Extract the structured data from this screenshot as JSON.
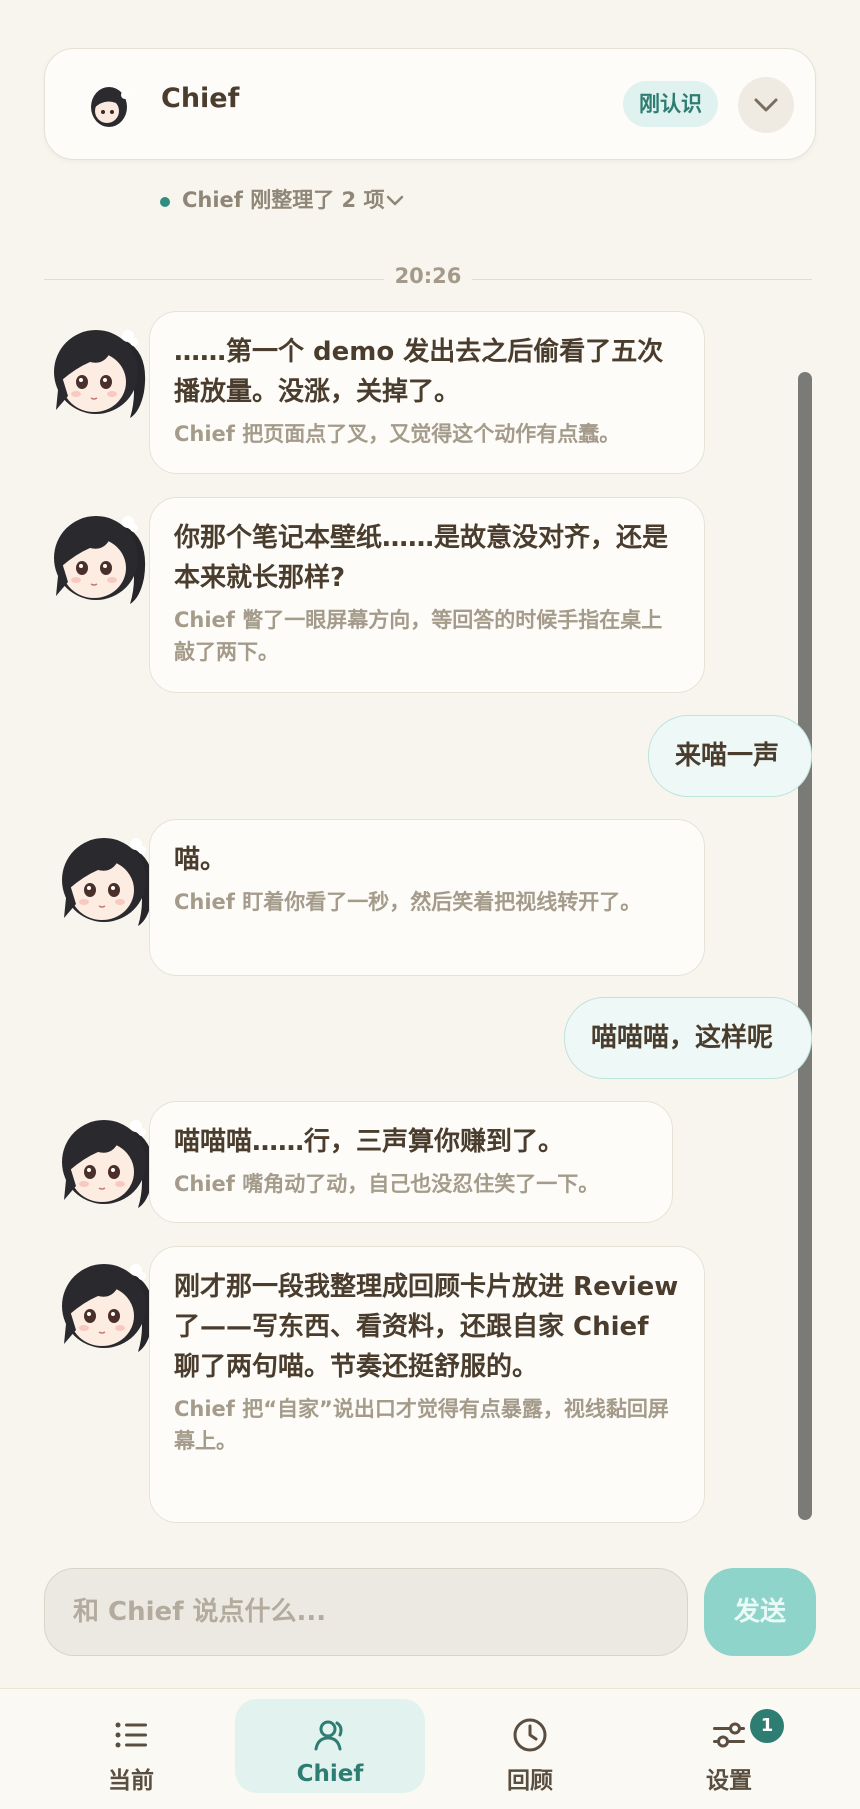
{
  "header": {
    "title": "Chief",
    "badge": "刚认识"
  },
  "status": {
    "text": "Chief 刚整理了 2 项"
  },
  "timestamp": "20:26",
  "messages": [
    {
      "main": "……第一个 demo 发出去之后偷看了五次播放量。没涨，关掉了。",
      "sub": "Chief 把页面点了叉，又觉得这个动作有点蠢。"
    },
    {
      "main": "你那个笔记本壁纸……是故意没对齐，还是本来就长那样?",
      "sub": "Chief 瞥了一眼屏幕方向，等回答的时候手指在桌上敲了两下。"
    },
    {
      "main": "喵。",
      "sub": "Chief 盯着你看了一秒，然后笑着把视线转开了。"
    },
    {
      "main": "喵喵喵……行，三声算你赚到了。",
      "sub": "Chief 嘴角动了动，自己也没忍住笑了一下。"
    },
    {
      "main": "刚才那一段我整理成回顾卡片放进 Review 了——写东西、看资料，还跟自家 Chief 聊了两句喵。节奏还挺舒服的。",
      "sub": "Chief 把“自家”说出口才觉得有点暴露，视线黏回屏幕上。"
    }
  ],
  "user_messages": [
    "来喵一声",
    "喵喵喵，这样呢"
  ],
  "composer": {
    "placeholder": "和 Chief 说点什么...",
    "send_label": "发送"
  },
  "tabs": [
    {
      "label": "当前",
      "icon": "list-icon"
    },
    {
      "label": "Chief",
      "icon": "user-icon"
    },
    {
      "label": "回顾",
      "icon": "clock-icon"
    },
    {
      "label": "设置",
      "icon": "sliders-icon",
      "badge": "1"
    }
  ],
  "colors": {
    "accent": "#2e7d73",
    "send_button": "#8fd4ca",
    "background": "#f8f5ee"
  }
}
